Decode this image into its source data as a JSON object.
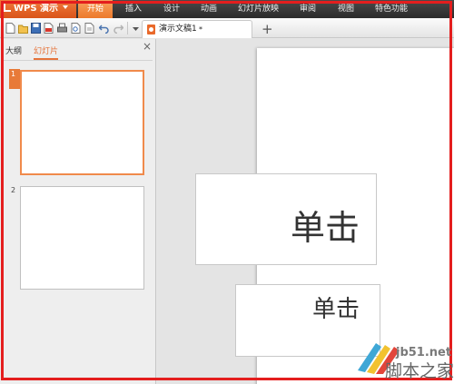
{
  "app": {
    "name": "WPS 演示"
  },
  "menu": [
    {
      "label": "开始",
      "active": true
    },
    {
      "label": "插入",
      "active": false
    },
    {
      "label": "设计",
      "active": false
    },
    {
      "label": "动画",
      "active": false
    },
    {
      "label": "幻灯片放映",
      "active": false
    },
    {
      "label": "审阅",
      "active": false
    },
    {
      "label": "视图",
      "active": false
    },
    {
      "label": "特色功能",
      "active": false
    }
  ],
  "toolbar": {
    "icons": [
      "new-icon",
      "open-icon",
      "save-icon",
      "export-pdf-icon",
      "print-icon",
      "print-preview-icon",
      "preview-icon",
      "undo-icon",
      "redo-icon",
      "customize-dropdown-icon"
    ]
  },
  "document_tab": {
    "title": "演示文稿1",
    "modified_mark": "*"
  },
  "new_tab_symbol": "+",
  "left_panel": {
    "tabs": [
      {
        "label": "大纲",
        "active": false
      },
      {
        "label": "幻灯片",
        "active": true
      }
    ],
    "close_symbol": "×",
    "slides": [
      {
        "number": "1",
        "selected": true
      },
      {
        "number": "2",
        "selected": false
      }
    ]
  },
  "slide": {
    "title_placeholder": "单击",
    "subtitle_placeholder": "单击"
  },
  "watermark": {
    "url": "jb51.net",
    "text": "脚本之家"
  },
  "colors": {
    "accent": "#e87a38",
    "highlight_frame": "#e41e1e",
    "menubar": "#333333"
  }
}
